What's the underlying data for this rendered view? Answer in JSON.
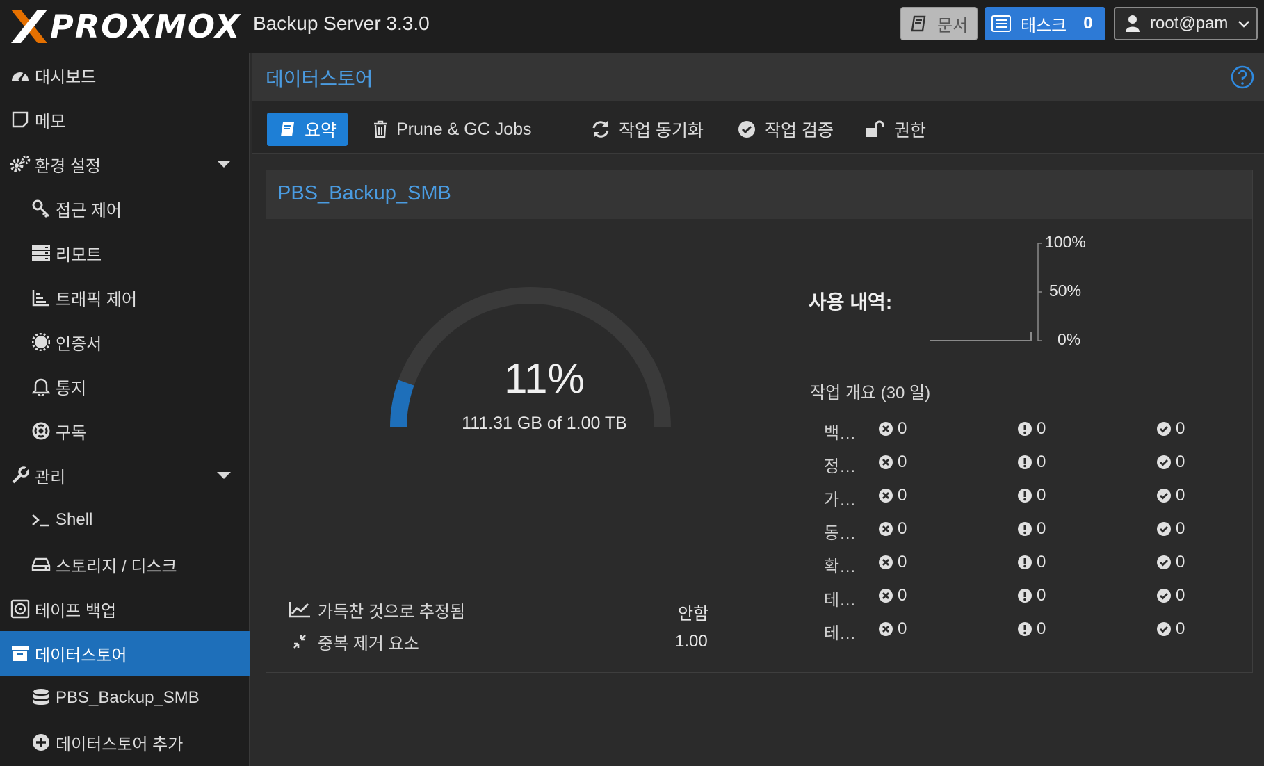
{
  "app": {
    "logo": "PROXMOX",
    "product": "Backup Server 3.3.0",
    "docs_label": "문서",
    "tasks_label": "태스크",
    "tasks_count": "0",
    "user_label": "root@pam"
  },
  "sidebar": {
    "items": [
      {
        "label": "대시보드",
        "icon": "dashboard-icon"
      },
      {
        "label": "메모",
        "icon": "note-icon"
      },
      {
        "label": "환경 설정",
        "icon": "gears-icon"
      },
      {
        "label": "접근 제어",
        "icon": "key-icon"
      },
      {
        "label": "리모트",
        "icon": "server-icon"
      },
      {
        "label": "트래픽 제어",
        "icon": "chart-bars-icon"
      },
      {
        "label": "인증서",
        "icon": "certificate-icon"
      },
      {
        "label": "통지",
        "icon": "bell-icon"
      },
      {
        "label": "구독",
        "icon": "lifebuoy-icon"
      },
      {
        "label": "관리",
        "icon": "wrench-icon"
      },
      {
        "label": "Shell",
        "icon": "terminal-icon"
      },
      {
        "label": "스토리지 / 디스크",
        "icon": "hdd-icon"
      },
      {
        "label": "테이프 백업",
        "icon": "tape-icon"
      },
      {
        "label": "데이터스토어",
        "icon": "archive-icon"
      },
      {
        "label": "PBS_Backup_SMB",
        "icon": "database-icon"
      },
      {
        "label": "데이터스토어 추가",
        "icon": "plus-circle-icon"
      }
    ]
  },
  "main": {
    "title": "데이터스토어",
    "tabs": [
      {
        "label": "요약",
        "icon": "book-icon"
      },
      {
        "label": "Prune & GC Jobs",
        "icon": "trash-icon"
      },
      {
        "label": "작업 동기화",
        "icon": "refresh-icon"
      },
      {
        "label": "작업 검증",
        "icon": "check-circle-icon"
      },
      {
        "label": "권한",
        "icon": "unlock-icon"
      }
    ]
  },
  "panel": {
    "title": "PBS_Backup_SMB",
    "gauge": {
      "percent_text": "11%",
      "fraction": 0.11,
      "usage_text": "111.31 GB of 1.00 TB",
      "color": "#1e6fba"
    },
    "estimated_full_label": "가득찬 것으로 추정됨",
    "estimated_full_value": "안함",
    "dedup_label": "중복 제거 요소",
    "dedup_value": "1.00",
    "usage_label": "사용 내역:",
    "usage_ticks": [
      "100%",
      "50%",
      "0%"
    ],
    "tasks_label": "작업 개요 (30 일)",
    "task_rows": [
      {
        "label": "백…",
        "error": "0",
        "warning": "0",
        "ok": "0"
      },
      {
        "label": "정…",
        "error": "0",
        "warning": "0",
        "ok": "0"
      },
      {
        "label": "가…",
        "error": "0",
        "warning": "0",
        "ok": "0"
      },
      {
        "label": "동…",
        "error": "0",
        "warning": "0",
        "ok": "0"
      },
      {
        "label": "확…",
        "error": "0",
        "warning": "0",
        "ok": "0"
      },
      {
        "label": "테…",
        "error": "0",
        "warning": "0",
        "ok": "0"
      },
      {
        "label": "테…",
        "error": "0",
        "warning": "0",
        "ok": "0"
      }
    ]
  }
}
